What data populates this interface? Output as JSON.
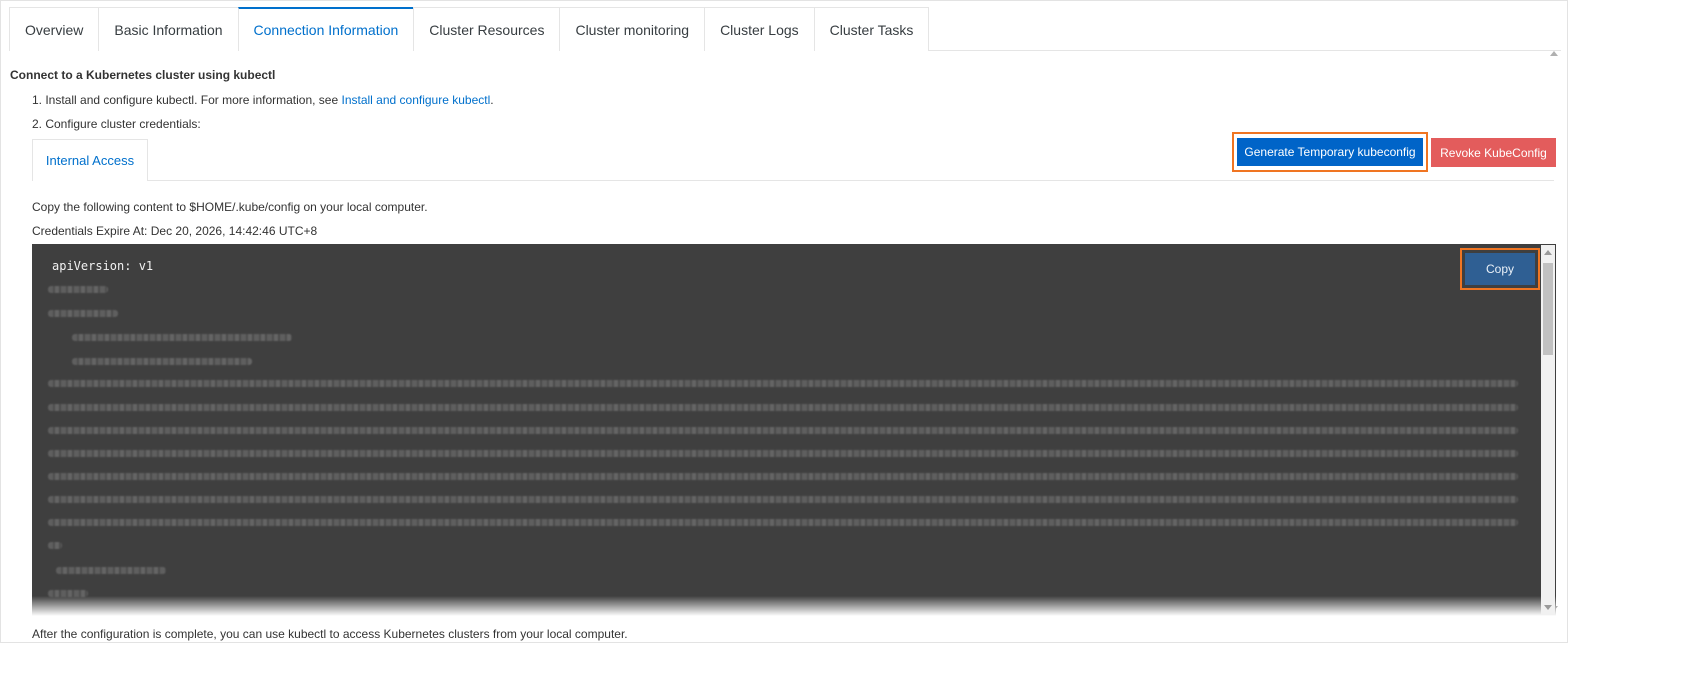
{
  "tabs": [
    {
      "label": "Overview",
      "active": false
    },
    {
      "label": "Basic Information",
      "active": false
    },
    {
      "label": "Connection Information",
      "active": true
    },
    {
      "label": "Cluster Resources",
      "active": false
    },
    {
      "label": "Cluster monitoring",
      "active": false
    },
    {
      "label": "Cluster Logs",
      "active": false
    },
    {
      "label": "Cluster Tasks",
      "active": false
    }
  ],
  "section": {
    "title": "Connect to a Kubernetes cluster using kubectl",
    "step1_text": "1. Install and configure kubectl. For more information, see ",
    "step1_link": "Install and configure kubectl",
    "step1_suffix": ".",
    "step2_text": "2. Configure cluster credentials:"
  },
  "inner_tab": {
    "label": "Internal Access"
  },
  "buttons": {
    "generate": "Generate Temporary kubeconfig",
    "revoke": "Revoke KubeConfig",
    "copy": "Copy"
  },
  "info": {
    "copy_instruction": "Copy the following content to $HOME/.kube/config on your local computer.",
    "expires": "Credentials Expire At: Dec 20, 2026, 14:42:46 UTC+8"
  },
  "code": {
    "first_line": "apiVersion: v1"
  },
  "footer": {
    "text": "After the configuration is complete, you can use kubectl to access Kubernetes clusters from your local computer."
  },
  "colors": {
    "accent": "#0070cc",
    "primary_button": "#0064c8",
    "danger_button": "#e35c5c",
    "highlight_border": "#f07522",
    "code_background": "#3f3f3f"
  }
}
